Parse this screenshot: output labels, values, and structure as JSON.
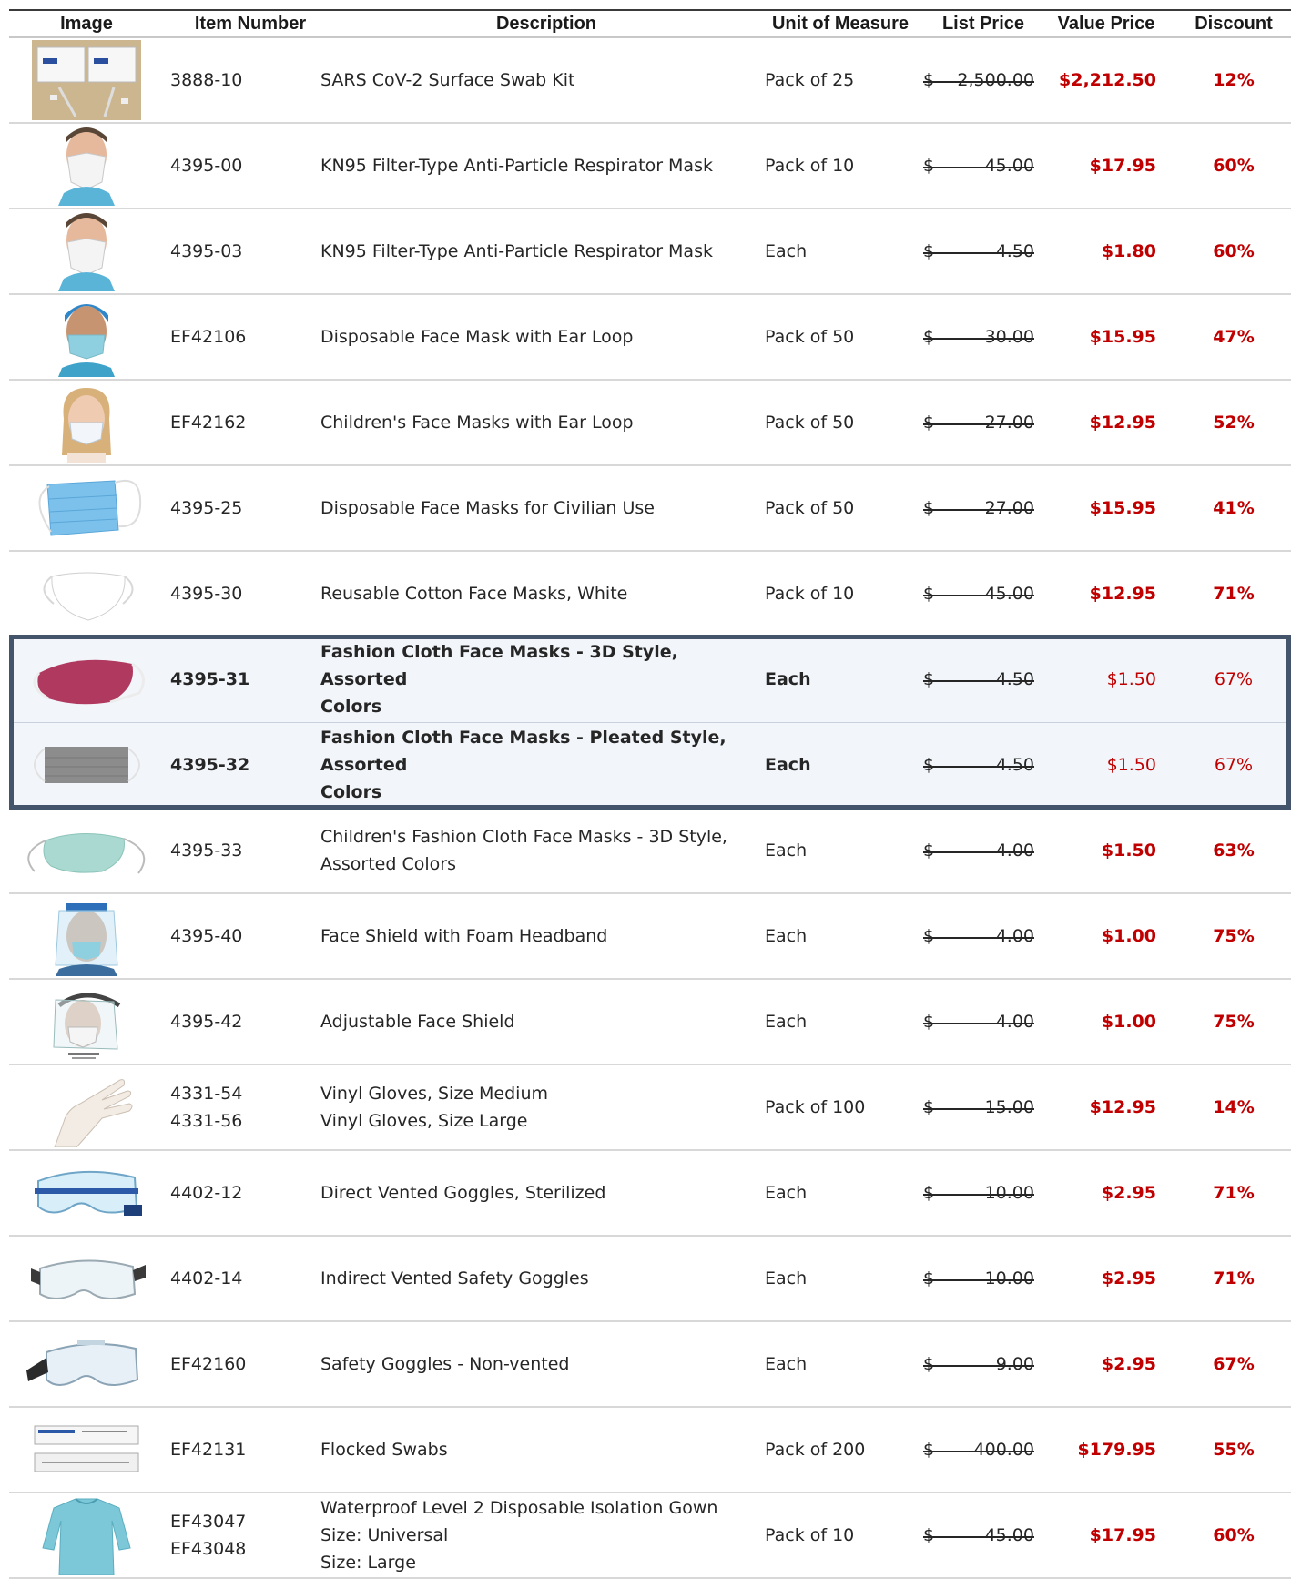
{
  "headers": {
    "image": "Image",
    "item_number": "Item Number",
    "description": "Description",
    "unit": "Unit of Measure",
    "list_price": "List Price",
    "value_price": "Value Price",
    "discount": "Discount"
  },
  "rows": [
    {
      "image": "swab-kit-box",
      "item": "3888-10",
      "desc": "SARS CoV-2 Surface Swab Kit",
      "uom": "Pack of 25",
      "cur": "$",
      "list": "2,500.00",
      "value": "$2,212.50",
      "disc": "12%"
    },
    {
      "image": "kn95-mask",
      "item": "4395-00",
      "desc": "KN95 Filter-Type Anti-Particle Respirator Mask",
      "uom": "Pack of 10",
      "cur": "$",
      "list": "45.00",
      "value": "$17.95",
      "disc": "60%"
    },
    {
      "image": "kn95-mask",
      "item": "4395-03",
      "desc": "KN95 Filter-Type Anti-Particle Respirator Mask",
      "uom": "Each",
      "cur": "$",
      "list": "4.50",
      "value": "$1.80",
      "disc": "60%"
    },
    {
      "image": "surgical-mask-cap",
      "item": "EF42106",
      "desc": "Disposable Face Mask with Ear Loop",
      "uom": "Pack of 50",
      "cur": "$",
      "list": "30.00",
      "value": "$15.95",
      "disc": "47%"
    },
    {
      "image": "child-mask",
      "item": "EF42162",
      "desc": "Children's Face Masks with Ear Loop",
      "uom": "Pack of 50",
      "cur": "$",
      "list": "27.00",
      "value": "$12.95",
      "disc": "52%"
    },
    {
      "image": "blue-pleated-mask",
      "item": "4395-25",
      "desc": "Disposable Face Masks for Civilian Use",
      "uom": "Pack of 50",
      "cur": "$",
      "list": "27.00",
      "value": "$15.95",
      "disc": "41%"
    },
    {
      "image": "white-cotton-mask",
      "item": "4395-30",
      "desc": "Reusable Cotton Face Masks, White",
      "uom": "Pack of 10",
      "cur": "$",
      "list": "45.00",
      "value": "$12.95",
      "disc": "71%"
    },
    {
      "image": "red-3d-mask",
      "item": "4395-31",
      "desc": "Fashion Cloth Face Masks - 3D Style, Assorted\nColors",
      "uom": "Each",
      "cur": "$",
      "list": "4.50",
      "value": "$1.50",
      "disc": "67%",
      "highlight": true
    },
    {
      "image": "gray-pleated-mask",
      "item": "4395-32",
      "desc": "Fashion Cloth Face Masks - Pleated Style, Assorted\nColors",
      "uom": "Each",
      "cur": "$",
      "list": "4.50",
      "value": "$1.50",
      "disc": "67%",
      "highlight": true
    },
    {
      "image": "teal-3d-mask",
      "item": "4395-33",
      "desc": "Children's Fashion Cloth Face Masks - 3D Style,\nAssorted Colors",
      "uom": "Each",
      "cur": "$",
      "list": "4.00",
      "value": "$1.50",
      "disc": "63%"
    },
    {
      "image": "face-shield-foam",
      "item": "4395-40",
      "desc": "Face Shield with Foam Headband",
      "uom": "Each",
      "cur": "$",
      "list": "4.00",
      "value": "$1.00",
      "disc": "75%"
    },
    {
      "image": "adjustable-face-shield",
      "item": "4395-42",
      "desc": "Adjustable Face Shield",
      "uom": "Each",
      "cur": "$",
      "list": "4.00",
      "value": "$1.00",
      "disc": "75%"
    },
    {
      "image": "vinyl-glove",
      "item": "4331-54\n4331-56",
      "desc": "Vinyl Gloves, Size Medium\nVinyl Gloves, Size Large",
      "uom": "Pack of 100",
      "cur": "$",
      "list": "15.00",
      "value": "$12.95",
      "disc": "14%"
    },
    {
      "image": "vented-goggles",
      "item": "4402-12",
      "desc": "Direct Vented Goggles, Sterilized",
      "uom": "Each",
      "cur": "$",
      "list": "10.00",
      "value": "$2.95",
      "disc": "71%"
    },
    {
      "image": "safety-goggles",
      "item": "4402-14",
      "desc": "Indirect Vented Safety Goggles",
      "uom": "Each",
      "cur": "$",
      "list": "10.00",
      "value": "$2.95",
      "disc": "71%"
    },
    {
      "image": "nonvented-goggles",
      "item": "EF42160",
      "desc": "Safety Goggles - Non-vented",
      "uom": "Each",
      "cur": "$",
      "list": "9.00",
      "value": "$2.95",
      "disc": "67%"
    },
    {
      "image": "flocked-swabs",
      "item": "EF42131",
      "desc": "Flocked Swabs",
      "uom": "Pack of 200",
      "cur": "$",
      "list": "400.00",
      "value": "$179.95",
      "disc": "55%"
    },
    {
      "image": "isolation-gown",
      "item": "EF43047\nEF43048",
      "desc": "Waterproof Level 2 Disposable Isolation Gown\nSize: Universal\nSize: Large",
      "uom": "Pack of 10",
      "cur": "$",
      "list": "45.00",
      "value": "$17.95",
      "disc": "60%"
    }
  ],
  "colors": {
    "value_red": "#c00000",
    "highlight_border": "#44546a",
    "highlight_fill": "#f2f6fa"
  }
}
